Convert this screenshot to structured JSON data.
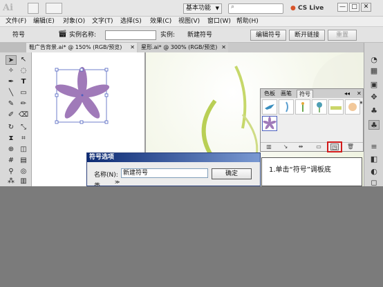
{
  "app": {
    "logo": "Ai",
    "workspace": "基本功能",
    "cs_live": "CS Live",
    "window_controls": [
      "—",
      "□",
      "✕"
    ]
  },
  "menu": [
    "文件(F)",
    "编辑(E)",
    "对象(O)",
    "文字(T)",
    "选择(S)",
    "效果(C)",
    "视图(V)",
    "窗口(W)",
    "帮助(H)"
  ],
  "control": {
    "symbol_label": "符号",
    "instance_name_label": "实例名称:",
    "instance_value": "",
    "instance_of_label": "实例:",
    "instance_of_value": "新建符号",
    "edit_symbol": "编辑符号",
    "break_link": "断开链接",
    "reset": "重置"
  },
  "tabs": [
    {
      "label": "鞋广告背景.ai* @ 150% (RGB/预览)",
      "close": "✕"
    },
    {
      "label": "星形.ai* @ 300% (RGB/预览)",
      "close": "✕"
    }
  ],
  "panel": {
    "tabs": [
      "色板",
      "画笔",
      "符号"
    ],
    "active_tab": "符号",
    "collapse": "◂◂",
    "close": "✕",
    "menu": "▾≡"
  },
  "dialog": {
    "title": "符号选项",
    "name_label": "名称(N):",
    "name_value": "新建符号",
    "type_label": "类",
    "ok": "确定"
  },
  "callout": {
    "text": "1.单击“符号”调板底"
  },
  "colors": {
    "flower": "#a07ab9",
    "selection": "#4b5fbf",
    "highlight": "#d21a1a"
  }
}
